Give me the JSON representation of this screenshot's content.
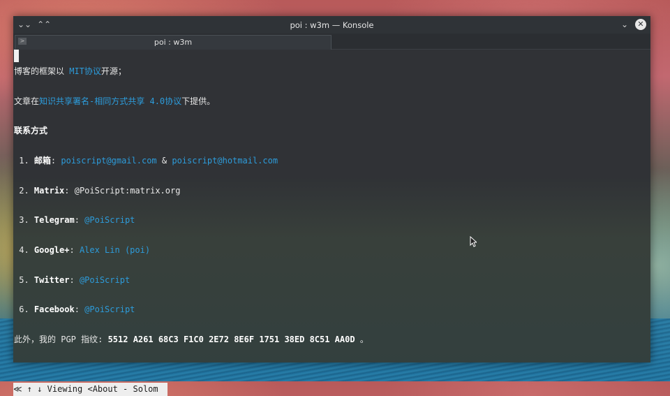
{
  "window": {
    "title": "poi : w3m — Konsole"
  },
  "tab": {
    "label": "poi : w3m"
  },
  "content": {
    "line1": {
      "pre": "博客的框架以 ",
      "link": "MIT协议",
      "post": "开源；"
    },
    "line2": {
      "pre": "文章在",
      "link": "知识共享署名-相同方式共享 4.0协议",
      "post": "下提供。"
    },
    "heading": "联系方式",
    "contacts": [
      {
        "num": " 1. ",
        "label": "邮箱",
        "sep": ": ",
        "link1": "poiscript@gmail.com",
        "amp": " & ",
        "link2": "poiscript@hotmail.com"
      },
      {
        "num": " 2. ",
        "label": "Matrix",
        "sep": ": ",
        "text": "@PoiScript:matrix.org"
      },
      {
        "num": " 3. ",
        "label": "Telegram",
        "sep": ": ",
        "link": "@PoiScript"
      },
      {
        "num": " 4. ",
        "label": "Google+",
        "sep": ": ",
        "link": "Alex Lin (poi)"
      },
      {
        "num": " 5. ",
        "label": "Twitter",
        "sep": ": ",
        "link": "@PoiScript"
      },
      {
        "num": " 6. ",
        "label": "Facebook",
        "sep": ": ",
        "link": "@PoiScript"
      }
    ],
    "pgp": {
      "pre": "此外，我的 PGP 指纹: ",
      "fingerprint": "5512 A261 68C3 F1C0 2E72 8E6F 1751 38ED 8C51 AA0D",
      "post": " 。"
    }
  },
  "status": "≪ ↑ ↓ Viewing <About - Solom",
  "colors": {
    "link": "#2d9cdb",
    "background": "#2b2e32"
  }
}
